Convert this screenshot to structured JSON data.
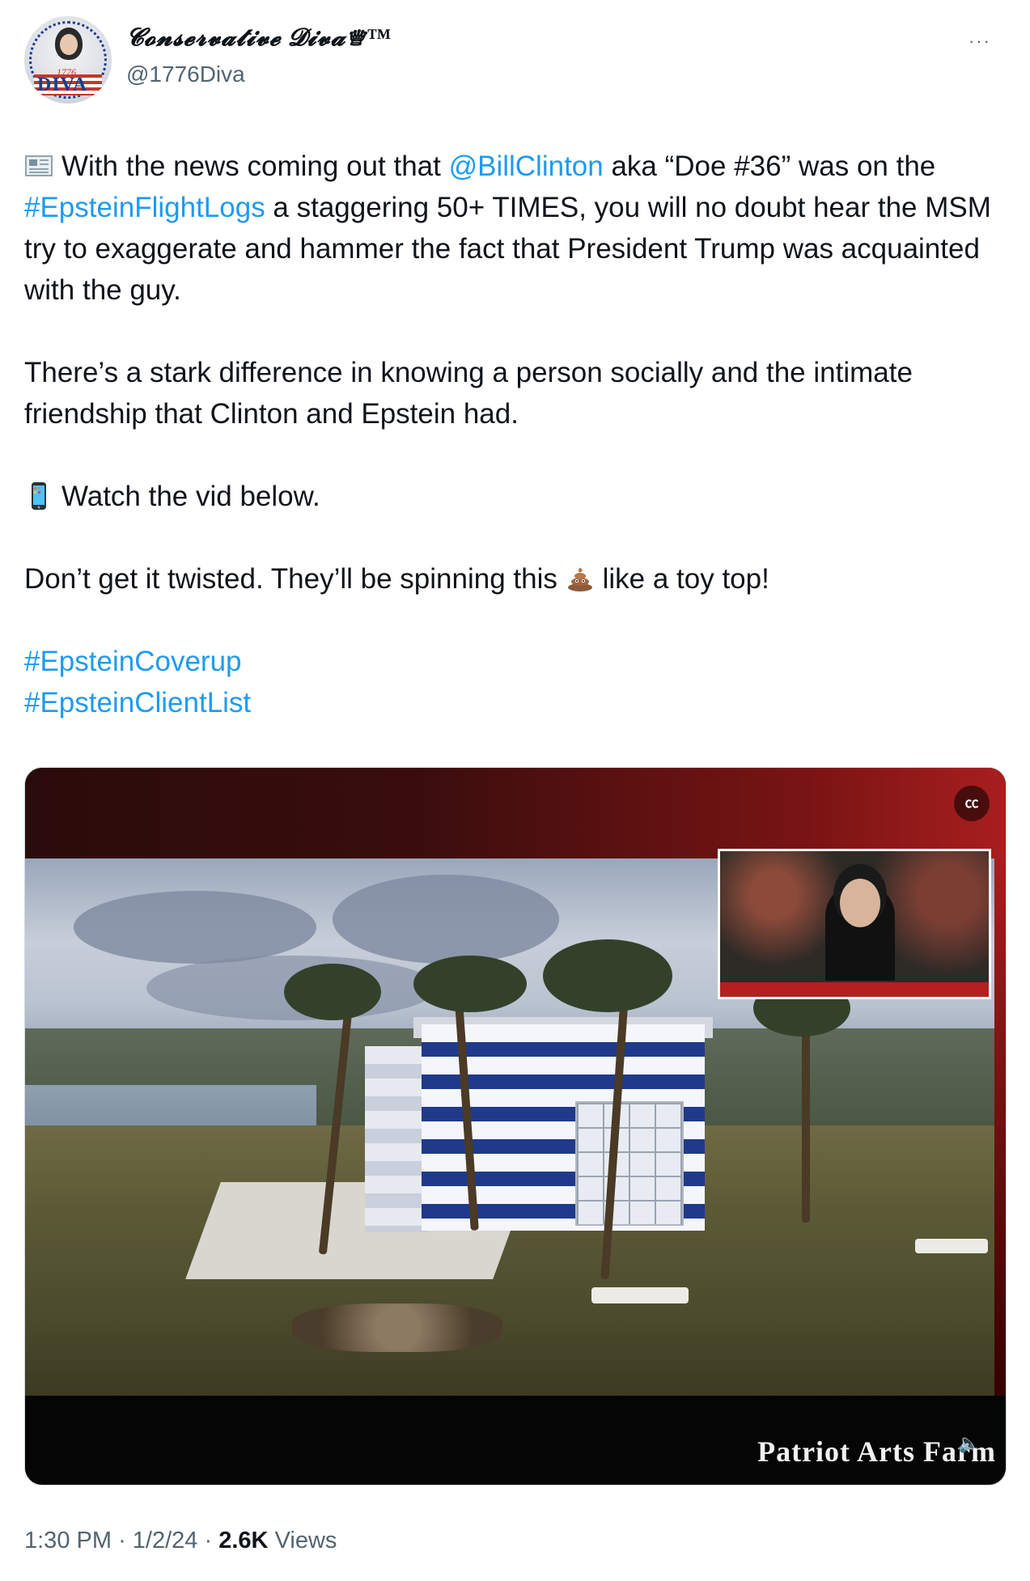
{
  "author": {
    "display_name": "𝓒𝓸𝓷𝓼𝓮𝓻𝓿𝓪𝓽𝓲𝓿𝓮 𝓓𝓲𝓿𝓪♕™",
    "handle": "@1776Diva",
    "avatar_year": "1776",
    "avatar_text": "DIVA"
  },
  "more_label": "···",
  "tweet": {
    "p1_emoji": "newspaper-icon",
    "p1_a": "With the news coming out that ",
    "p1_mention": "@BillClinton",
    "p1_b": " aka “Doe #36” was on the ",
    "p1_hashtag": "#EpsteinFlightLogs",
    "p1_c": " a staggering 50+ TIMES, you will no doubt hear the MSM try to exaggerate and hammer the fact that President Trump was acquainted with the guy.",
    "p2": "There’s a stark difference in knowing a person socially and the intimate friendship that Clinton and Epstein had.",
    "p3_emoji": "mobile-phone-icon",
    "p3": "Watch the vid below.",
    "p4_a": "Don’t get it twisted. They’ll be spinning this ",
    "p4_emoji": "pile-of-poo-icon",
    "p4_b": "like a toy top!",
    "hashtag1": "#EpsteinCoverup",
    "hashtag2": "#EpsteinClientList"
  },
  "media": {
    "watermark": "Patriot Arts Farm",
    "cc_icon": "captions-off-icon",
    "cc_label": "㏄",
    "volume_icon": "volume-icon",
    "volume_glyph": "🔈"
  },
  "meta": {
    "time": "1:30 PM",
    "date": "1/2/24",
    "views": "2.6K",
    "views_label": "Views",
    "separator": "·"
  },
  "colors": {
    "link": "#1d9bf0",
    "text": "#0f1419",
    "secondary": "#536471"
  }
}
